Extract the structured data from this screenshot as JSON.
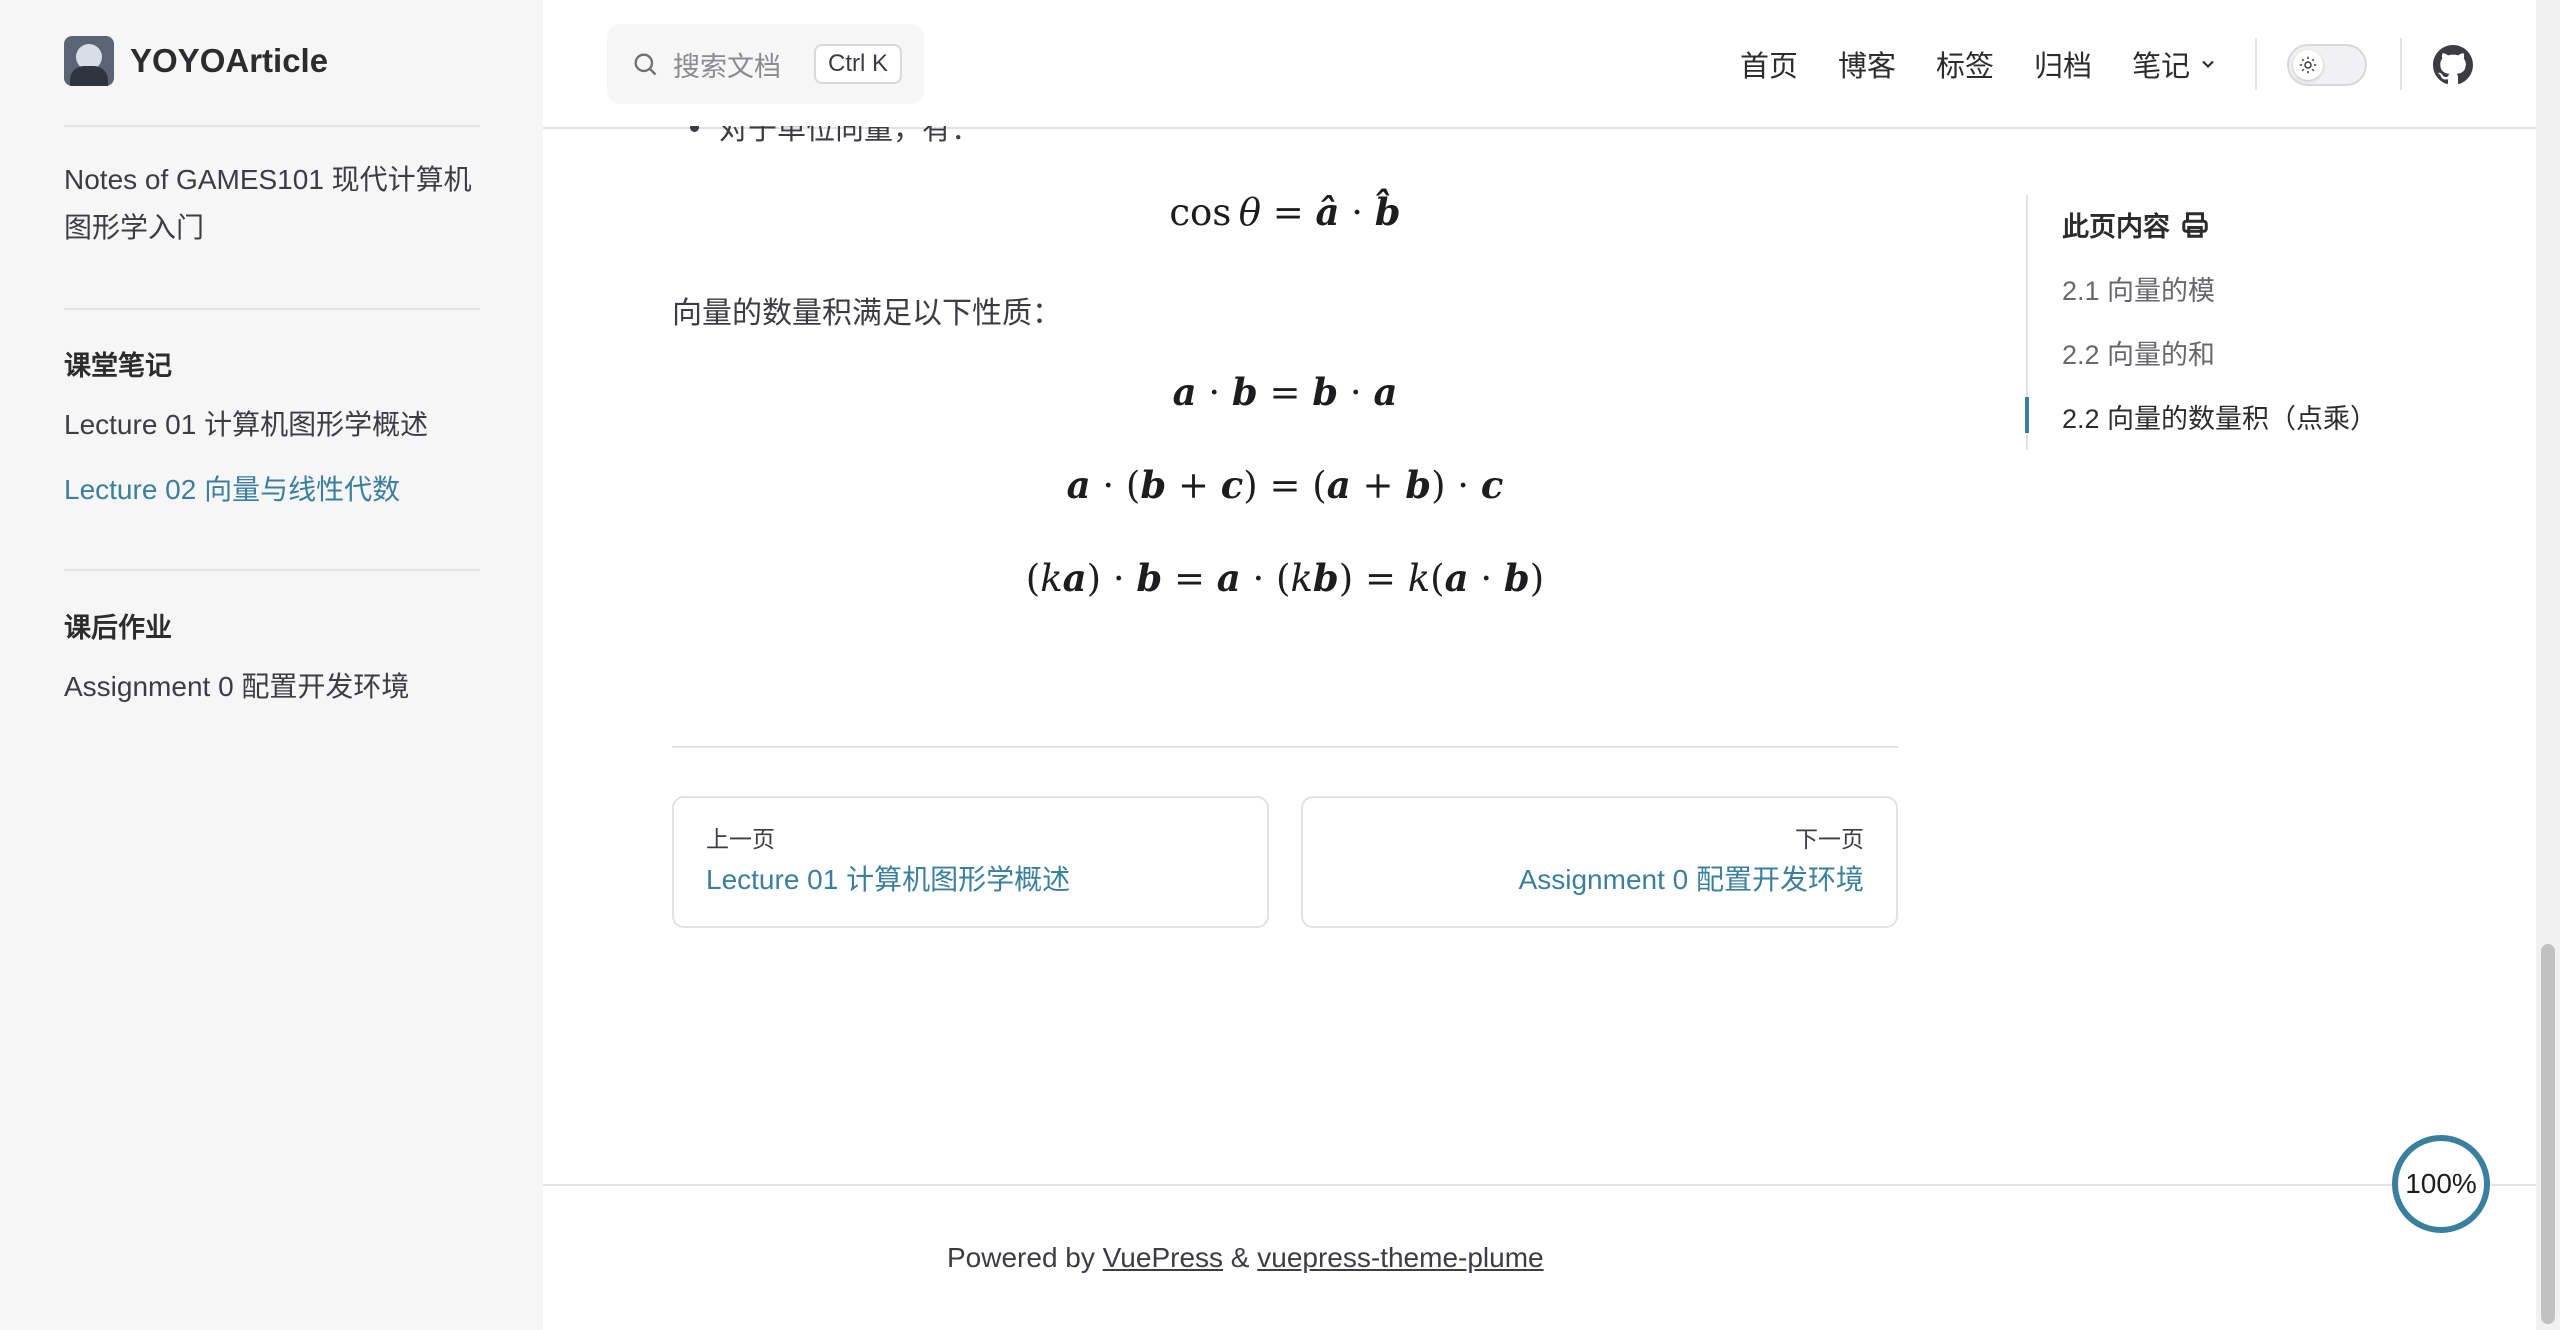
{
  "site": {
    "name": "YOYOArticle"
  },
  "sidebar": {
    "top_link": "Notes of GAMES101 现代计算机图形学入门",
    "groups": [
      {
        "title": "课堂笔记",
        "items": [
          "Lecture 01 计算机图形学概述",
          "Lecture 02 向量与线性代数"
        ]
      },
      {
        "title": "课后作业",
        "items": [
          "Assignment 0 配置开发环境"
        ]
      }
    ],
    "active_item": "Lecture 02 向量与线性代数"
  },
  "search": {
    "placeholder": "搜索文档",
    "shortcut": "Ctrl K"
  },
  "nav": {
    "items": [
      "首页",
      "博客",
      "标签",
      "归档",
      "笔记"
    ]
  },
  "theme_toggle": {
    "mode": "light"
  },
  "article": {
    "bullet_text": "对于单位向量，有：",
    "formula_unit": "cos θ = â · b̂",
    "properties_intro": "向量的数量积满足以下性质：",
    "formulas": [
      "a · b = b · a",
      "a · (b + c) = (a + b) · c",
      "(ka) · b = a · (kb) = k(a · b)"
    ]
  },
  "pager": {
    "prev": {
      "desc": "上一页",
      "title": "Lecture 01 计算机图形学概述"
    },
    "next": {
      "desc": "下一页",
      "title": "Assignment 0 配置开发环境"
    }
  },
  "toc": {
    "title": "此页内容",
    "items": [
      "2.1 向量的模",
      "2.2 向量的和",
      "2.2 向量的数量积（点乘）"
    ],
    "active_index": 2
  },
  "footer": {
    "prefix": "Powered by",
    "link1": "VuePress",
    "amp": "&",
    "link2": "vuepress-theme-plume"
  },
  "reading_progress": "100%",
  "colors": {
    "accent": "#3b7f9f",
    "sidebar_bg": "#f6f6f7",
    "divider": "#e2e2e3"
  }
}
